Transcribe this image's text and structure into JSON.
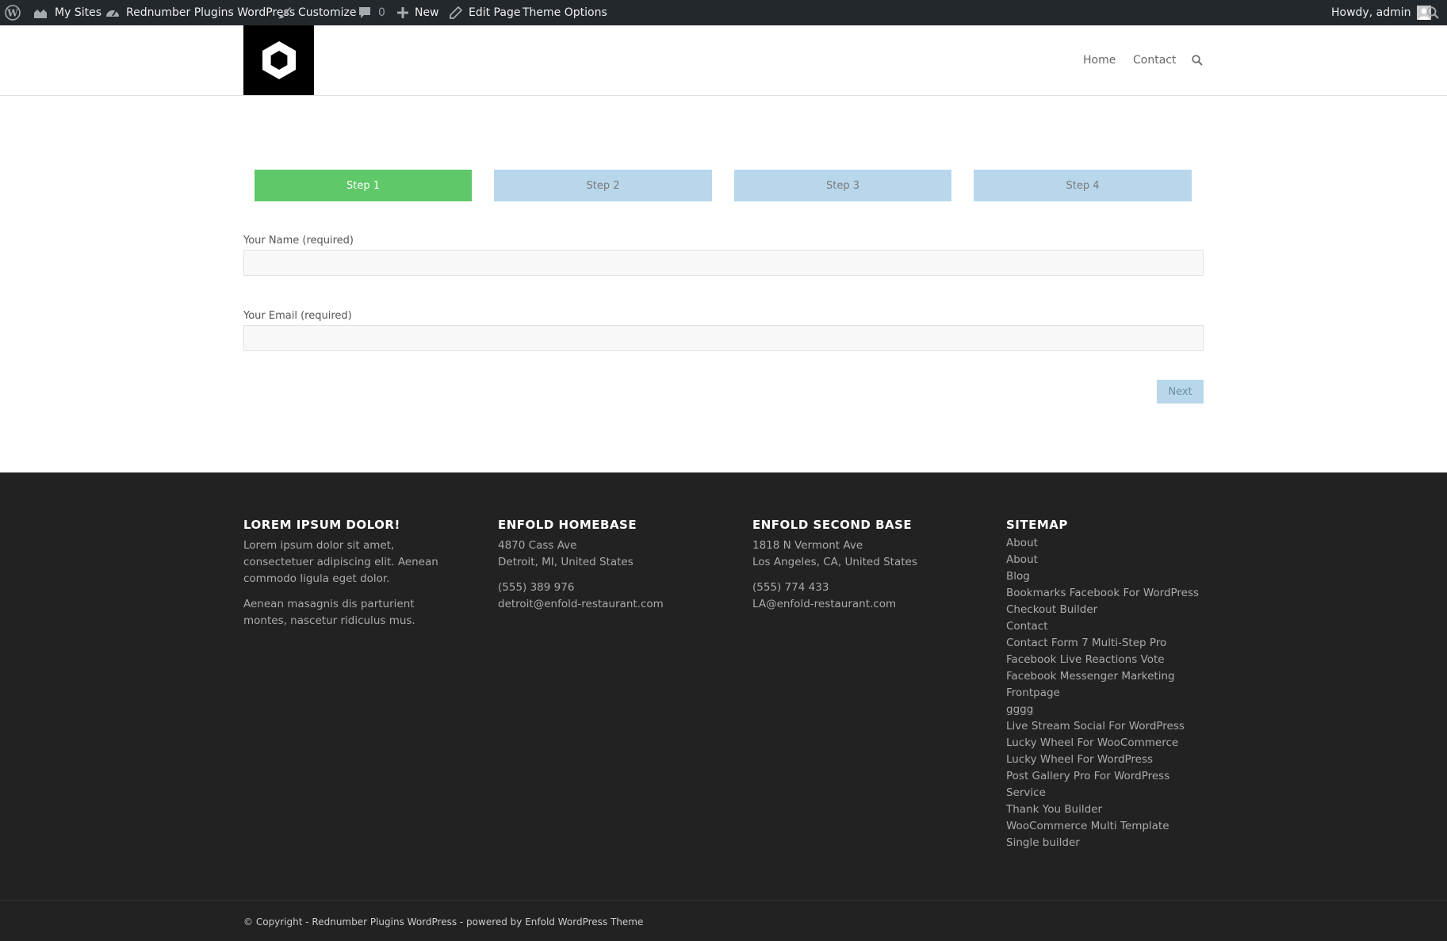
{
  "admin_bar": {
    "wp_logo_icon": "wordpress-icon",
    "my_sites": "My Sites",
    "site_name": "Rednumber Plugins WordPress",
    "customize": "Customize",
    "comments_count": "0",
    "new": "New",
    "edit_page": "Edit Page",
    "theme_options": "Theme Options",
    "howdy": "Howdy, admin"
  },
  "header": {
    "nav": [
      "Home",
      "Contact"
    ]
  },
  "steps": [
    "Step 1",
    "Step 2",
    "Step 3",
    "Step 4"
  ],
  "form": {
    "name_label": "Your Name (required)",
    "name_value": "",
    "email_label": "Your Email (required)",
    "email_value": "",
    "next_label": "Next"
  },
  "footer": {
    "col1": {
      "title": "LOREM IPSUM DOLOR!",
      "p1": "Lorem ipsum dolor sit amet, consectetuer adipiscing elit. Aenean commodo ligula eget dolor.",
      "p2": "Aenean masagnis dis parturient montes, nascetur ridiculus mus."
    },
    "col2": {
      "title": "ENFOLD HOMEBASE",
      "address1": "4870 Cass Ave",
      "address2": "Detroit, MI, United States",
      "phone": "(555) 389 976",
      "email": "detroit@enfold-restaurant.com"
    },
    "col3": {
      "title": "ENFOLD SECOND BASE",
      "address1": "1818 N Vermont Ave",
      "address2": "Los Angeles, CA, United States",
      "phone": "(555) 774 433",
      "email": "LA@enfold-restaurant.com"
    },
    "sitemap": {
      "title": "SITEMAP",
      "links": [
        "About",
        "About",
        "Blog",
        "Bookmarks Facebook For WordPress",
        "Checkout Builder",
        "Contact",
        "Contact Form 7 Multi-Step Pro",
        "Facebook Live Reactions Vote",
        "Facebook Messenger Marketing",
        "Frontpage",
        "gggg",
        "Live Stream Social For WordPress",
        "Lucky Wheel For WooCommerce",
        "Lucky Wheel For WordPress",
        "Post Gallery Pro For WordPress",
        "Service",
        "Thank You Builder",
        "WooCommerce Multi Template Single builder"
      ]
    }
  },
  "socket": {
    "copyright": "© Copyright - Rednumber Plugins WordPress - powered by Enfold WordPress Theme"
  },
  "colors": {
    "admin_bar_bg": "#23282d",
    "step_active": "#5fc868",
    "step_inactive": "#b8d7ea",
    "footer_bg": "#222222"
  }
}
